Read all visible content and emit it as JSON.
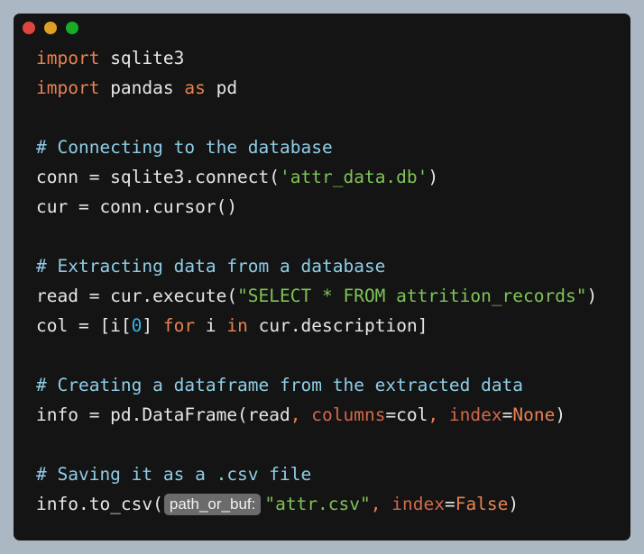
{
  "window": {
    "controls": [
      {
        "name": "close",
        "color": "#e0443e"
      },
      {
        "name": "minimize",
        "color": "#dea123"
      },
      {
        "name": "maximize",
        "color": "#1aab29"
      }
    ]
  },
  "colors": {
    "default": "#e6e6e6",
    "keyword": "#e8824f",
    "comment": "#8ecde6",
    "string": "#7ec456",
    "number": "#37b3e8",
    "param": "#d2694a",
    "constant": "#e8824f",
    "hint_bg": "#6b6b6b"
  },
  "code": {
    "lines": [
      [
        {
          "t": "import",
          "k": "keyword"
        },
        {
          "t": " sqlite3",
          "k": "default"
        }
      ],
      [
        {
          "t": "import",
          "k": "keyword"
        },
        {
          "t": " pandas ",
          "k": "default"
        },
        {
          "t": "as",
          "k": "keyword"
        },
        {
          "t": " pd",
          "k": "default"
        }
      ],
      [],
      [
        {
          "t": "# Connecting to the database",
          "k": "comment"
        }
      ],
      [
        {
          "t": "conn = sqlite3.connect(",
          "k": "default"
        },
        {
          "t": "'attr_data.db'",
          "k": "string"
        },
        {
          "t": ")",
          "k": "default"
        }
      ],
      [
        {
          "t": "cur = conn.cursor()",
          "k": "default"
        }
      ],
      [],
      [
        {
          "t": "# Extracting data from a database",
          "k": "comment"
        }
      ],
      [
        {
          "t": "read = cur.execute(",
          "k": "default"
        },
        {
          "t": "\"SELECT * FROM attrition_records\"",
          "k": "string"
        },
        {
          "t": ")",
          "k": "default"
        }
      ],
      [
        {
          "t": "col = [i[",
          "k": "default"
        },
        {
          "t": "0",
          "k": "number"
        },
        {
          "t": "] ",
          "k": "default"
        },
        {
          "t": "for",
          "k": "keyword"
        },
        {
          "t": " i ",
          "k": "default"
        },
        {
          "t": "in",
          "k": "keyword"
        },
        {
          "t": " cur.description]",
          "k": "default"
        }
      ],
      [],
      [
        {
          "t": "# Creating a dataframe from the extracted data",
          "k": "comment"
        }
      ],
      [
        {
          "t": "info = pd.DataFrame(read",
          "k": "default"
        },
        {
          "t": ", ",
          "k": "keyword"
        },
        {
          "t": "columns",
          "k": "param"
        },
        {
          "t": "=col",
          "k": "default"
        },
        {
          "t": ", ",
          "k": "keyword"
        },
        {
          "t": "index",
          "k": "param"
        },
        {
          "t": "=",
          "k": "default"
        },
        {
          "t": "None",
          "k": "constant"
        },
        {
          "t": ")",
          "k": "default"
        }
      ],
      [],
      [
        {
          "t": "# Saving it as a .csv file",
          "k": "comment"
        }
      ],
      [
        {
          "t": "info.to_csv(",
          "k": "default"
        },
        {
          "t": "path_or_buf:",
          "k": "hint"
        },
        {
          "t": "\"attr.csv\"",
          "k": "string"
        },
        {
          "t": ", ",
          "k": "keyword"
        },
        {
          "t": "index",
          "k": "param"
        },
        {
          "t": "=",
          "k": "default"
        },
        {
          "t": "False",
          "k": "constant"
        },
        {
          "t": ")",
          "k": "default"
        }
      ]
    ]
  }
}
